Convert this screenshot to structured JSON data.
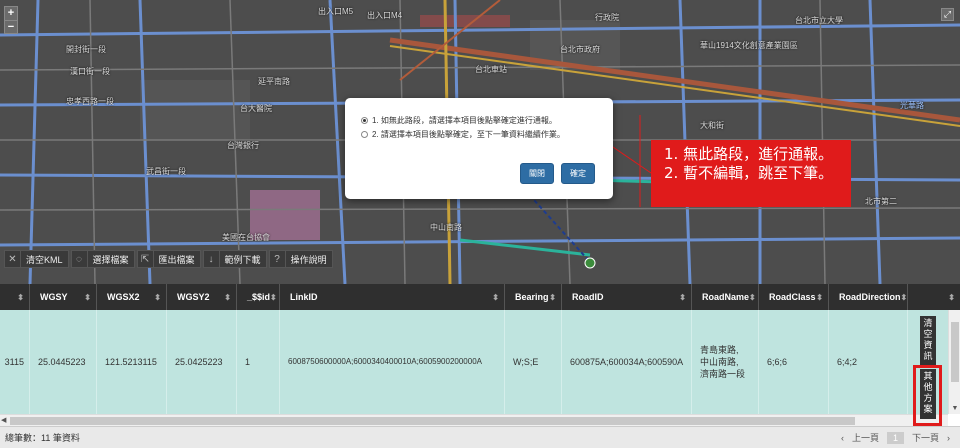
{
  "map": {
    "zoom_in": "+",
    "zoom_out": "−",
    "fullscreen_icon": "expand-icon",
    "labels": [
      {
        "text": "出入口M5",
        "cls": ""
      },
      {
        "text": "出入口M4",
        "cls": ""
      },
      {
        "text": "行政院",
        "cls": ""
      },
      {
        "text": "開封街一段",
        "cls": ""
      },
      {
        "text": "台北市政府",
        "cls": ""
      },
      {
        "text": "台大醫院",
        "cls": ""
      },
      {
        "text": "武昌街一段",
        "cls": ""
      },
      {
        "text": "台北車站",
        "cls": ""
      },
      {
        "text": "忠孝西路一段",
        "cls": ""
      },
      {
        "text": "中山南路",
        "cls": ""
      },
      {
        "text": "延平南路",
        "cls": ""
      },
      {
        "text": "台灣銀行",
        "cls": ""
      },
      {
        "text": "華山1914文化創意產業園區",
        "cls": ""
      },
      {
        "text": "台北市立大學",
        "cls": ""
      },
      {
        "text": "漢口街一段",
        "cls": ""
      },
      {
        "text": "北市第二",
        "cls": ""
      },
      {
        "text": "美國在台協會",
        "cls": ""
      },
      {
        "text": "大和街",
        "cls": ""
      },
      {
        "text": "光華路",
        "cls": "blue"
      }
    ]
  },
  "toolbar": [
    {
      "icon": "close-icon",
      "glyph": "✕",
      "label": "清空KML"
    },
    {
      "icon": "folder-icon",
      "glyph": "◌",
      "label": "選擇檔案"
    },
    {
      "icon": "export-icon",
      "glyph": "⇱",
      "label": "匯出檔案"
    },
    {
      "icon": "download-icon",
      "glyph": "↓",
      "label": "範例下載"
    },
    {
      "icon": "help-icon",
      "glyph": "?",
      "label": "操作說明"
    }
  ],
  "dialog": {
    "option1": "1. 如無此路段，請選擇本項目後點擊確定進行通報。",
    "option2": "2. 請選擇本項目後點擊確定，至下一筆資料繼續作業。",
    "close_label": "關閉",
    "confirm_label": "確定"
  },
  "annotation": {
    "line1": "1. 無此路段，進行通報。",
    "line2": "2. 暫不編輯，跳至下筆。"
  },
  "table": {
    "headers": [
      "",
      "WGSY",
      "WGSX2",
      "WGSY2",
      "_$$id",
      "LinkID",
      "Bearing",
      "RoadID",
      "RoadName",
      "RoadClass",
      "RoadDirection",
      ""
    ],
    "row": {
      "c0": "3115",
      "c1": "25.0445223",
      "c2": "121.5213115",
      "c3": "25.0425223",
      "c4": "1",
      "c5": "6008750600000A;6000340400010A;6005900200000A",
      "c6": "W;S;E",
      "c7": "600875A;600034A;600590A",
      "c8": "青島東路,\n中山南路,\n濟南路一段",
      "c9": "6;6;6",
      "c10": "6;4;2"
    },
    "side_clear": "清空資訊",
    "side_other": "其他方案"
  },
  "footer": {
    "total": "總筆數：11 筆資料",
    "prev": "上一頁",
    "page": "1",
    "next": "下一頁"
  }
}
